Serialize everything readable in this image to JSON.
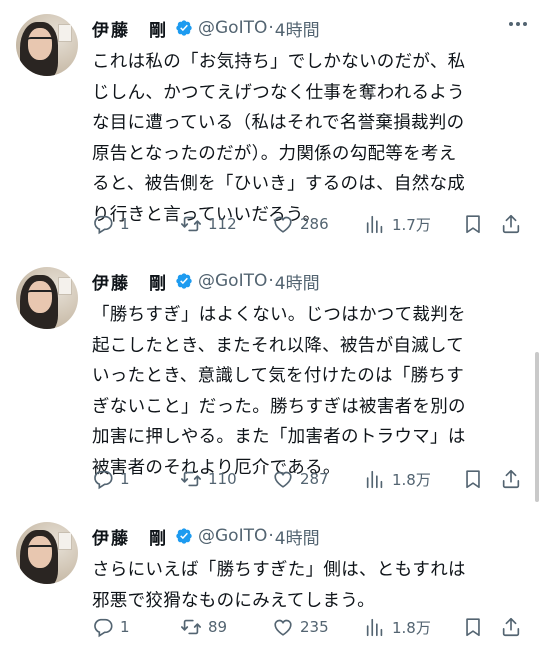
{
  "colors": {
    "text": "#0f1419",
    "secondary": "#536471",
    "verified": "#1d9bf0"
  },
  "tweets": [
    {
      "author": {
        "name": "伊藤　剛",
        "handle": "@GoITO",
        "time": "4時間"
      },
      "lines": [
        "これは私の「お気持ち」でしかないのだが、私",
        "じしん、かつてえげつなく仕事を奪われるよう",
        "な目に遭っている（私はそれで名誉棄損裁判の",
        "原告となったのだが）。力関係の勾配等を考え",
        "ると、被告側を「ひいき」するのは、自然な成",
        "り行きと言っていいだろう。"
      ],
      "stats": {
        "replies": "1",
        "retweets": "112",
        "likes": "286",
        "views": "1.7万"
      }
    },
    {
      "author": {
        "name": "伊藤　剛",
        "handle": "@GoITO",
        "time": "4時間"
      },
      "lines": [
        "「勝ちすぎ」はよくない。じつはかつて裁判を",
        "起こしたとき、またそれ以降、被告が自滅して",
        "いったとき、意識して気を付けたのは「勝ちす",
        "ぎないこと」だった。勝ちすぎは被害者を別の",
        "加害に押しやる。また「加害者のトラウマ」は",
        "被害者のそれより厄介である。"
      ],
      "stats": {
        "replies": "1",
        "retweets": "110",
        "likes": "287",
        "views": "1.8万"
      }
    },
    {
      "author": {
        "name": "伊藤　剛",
        "handle": "@GoITO",
        "time": "4時間"
      },
      "lines": [
        "さらにいえば「勝ちすぎた」側は、ともすれは",
        "邪悪で狡猾なものにみえてしまう。"
      ],
      "stats": {
        "replies": "1",
        "retweets": "89",
        "likes": "235",
        "views": "1.8万"
      }
    }
  ]
}
